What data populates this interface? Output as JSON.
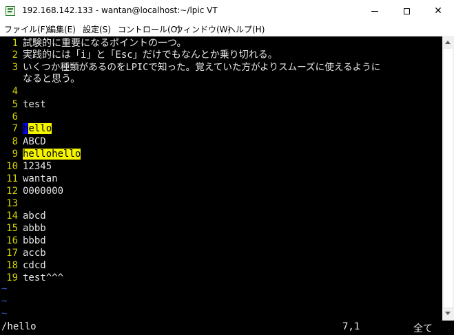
{
  "window": {
    "title": "192.168.142.133 - wantan@localhost:~/lpic VT"
  },
  "menu": [
    "ファイル(F)",
    "編集(E)",
    "設定(S)",
    "コントロール(O)",
    "ウィンドウ(W)",
    "ヘルプ(H)"
  ],
  "lines": [
    {
      "n": "1",
      "t": "試験的に重要になるポイントの一つ。"
    },
    {
      "n": "2",
      "t": "実践的には「i」と「Esc」だけでもなんとか乗り切れる。"
    },
    {
      "n": "3",
      "t": "いくつか種類があるのをLPICで知った。覚えていた方がよりスムーズに使えるように"
    },
    {
      "n": "",
      "t": "なると思う。"
    },
    {
      "n": "4",
      "t": ""
    },
    {
      "n": "5",
      "t": "test"
    },
    {
      "n": "6",
      "t": ""
    },
    {
      "n": "7",
      "t": "hello"
    },
    {
      "n": "8",
      "t": "ABCD"
    },
    {
      "n": "9",
      "t": "hellohello"
    },
    {
      "n": "10",
      "t": "12345"
    },
    {
      "n": "11",
      "t": "wantan"
    },
    {
      "n": "12",
      "t": "0000000"
    },
    {
      "n": "13",
      "t": ""
    },
    {
      "n": "14",
      "t": "abcd"
    },
    {
      "n": "15",
      "t": "abbb"
    },
    {
      "n": "16",
      "t": "bbbd"
    },
    {
      "n": "17",
      "t": "accb"
    },
    {
      "n": "18",
      "t": "cdcd"
    },
    {
      "n": "19",
      "t": "test^^^"
    }
  ],
  "highlight": {
    "l7_cursor": "h",
    "l7_rest": "ello",
    "l9": "hellohello"
  },
  "tilde": "~",
  "status": {
    "command": "/hello",
    "position": "7,1",
    "percent": "全て"
  },
  "colors": {
    "line_number": "#d4d400",
    "highlight": "#f5f500",
    "tilde": "#3a5fcd",
    "cursor": "#0000ee"
  }
}
